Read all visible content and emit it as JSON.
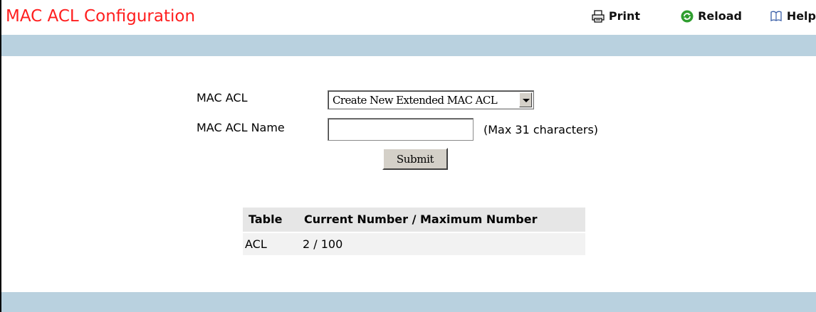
{
  "page": {
    "title": "MAC ACL Configuration"
  },
  "toolbar": {
    "print": "Print",
    "reload": "Reload",
    "help": "Help"
  },
  "form": {
    "mac_acl_label": "MAC ACL",
    "mac_acl_selected": "Create New Extended MAC ACL",
    "name_label": "MAC ACL Name",
    "name_value": "",
    "name_hint": "(Max 31 characters)",
    "submit": "Submit"
  },
  "table": {
    "headers": [
      "Table",
      "Current Number / Maximum Number"
    ],
    "rows": [
      {
        "table": "ACL",
        "count": "2 / 100"
      }
    ]
  },
  "colors": {
    "title": "#ff1e1e",
    "band": "#b9d1df"
  }
}
